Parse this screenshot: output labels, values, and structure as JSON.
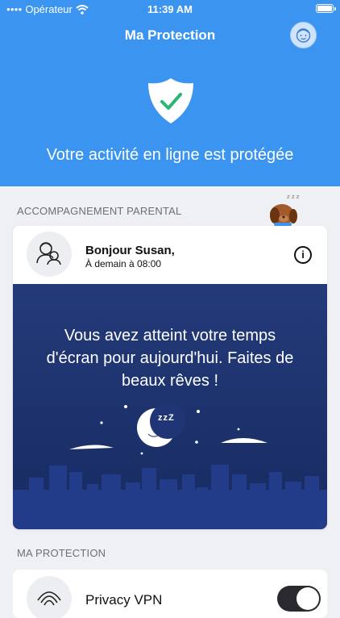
{
  "status": {
    "carrier": "Opérateur",
    "time": "11:39 AM"
  },
  "header": {
    "title": "Ma Protection",
    "message": "Votre activité en ligne est protégée"
  },
  "parental": {
    "section_label": "ACCOMPAGNEMENT PARENTAL",
    "greeting": "Bonjour Susan,",
    "subtitle": "À demain à 08:00",
    "info_glyph": "i",
    "bedtime_message": "Vous avez atteint votre temps d'écran pour aujourd'hui. Faites de beaux rêves !",
    "sleep_z": "zzZ"
  },
  "protection": {
    "section_label": "MA PROTECTION",
    "vpn_label": "Privacy VPN",
    "vpn_enabled": true
  },
  "colors": {
    "brand_blue": "#3b95f0",
    "night_blue": "#1c3170",
    "page_bg": "#eef0f4",
    "shield_check": "#2bb673"
  },
  "icons": [
    "wifi-icon",
    "battery-icon",
    "kid-avatar-icon",
    "shield-check-icon",
    "sleeping-dog-icon",
    "parent-child-icon",
    "info-icon",
    "moon-icon",
    "vpn-fingerprint-icon"
  ]
}
